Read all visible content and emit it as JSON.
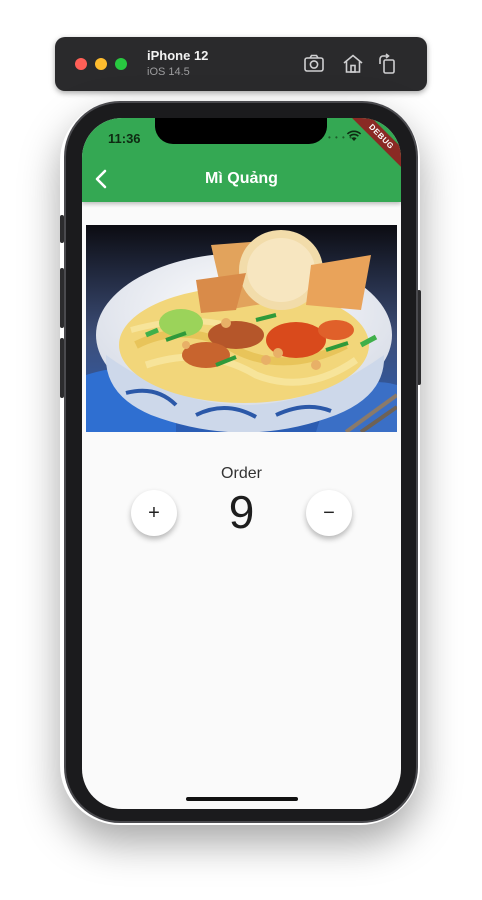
{
  "simulator": {
    "device_name": "iPhone 12",
    "os_version": "iOS 14.5",
    "icons": [
      "screenshot-icon",
      "home-icon",
      "rotate-icon"
    ]
  },
  "status_bar": {
    "time": "11:36",
    "debug_banner": "DEBUG"
  },
  "app_bar": {
    "title": "Mì Quảng",
    "back_icon": "back-arrow-icon",
    "color": "#34a853"
  },
  "content": {
    "image_subject": "bowl of Mì Quảng noodles",
    "order_label": "Order",
    "quantity": "9",
    "plus_symbol": "+",
    "minus_symbol": "−"
  }
}
